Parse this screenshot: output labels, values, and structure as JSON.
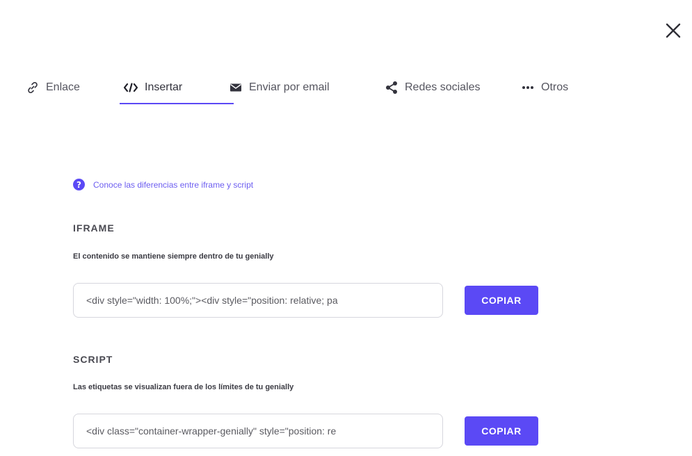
{
  "dialog": {
    "close_icon": "close-icon"
  },
  "tabs": [
    {
      "label": "Enlace",
      "icon": "link-icon"
    },
    {
      "label": "Insertar",
      "icon": "code-icon"
    },
    {
      "label": "Enviar por email",
      "icon": "mail-icon"
    },
    {
      "label": "Redes sociales",
      "icon": "share-icon"
    },
    {
      "label": "Otros",
      "icon": "more-horizontal-icon"
    }
  ],
  "active_tab": "Insertar",
  "help": {
    "icon_glyph": "?",
    "link_text": "Conoce las diferencias entre iframe y script"
  },
  "iframe": {
    "title": "IFRAME",
    "description": "El contenido se mantiene siempre dentro de tu genially",
    "code": "<div style=\"width: 100%;\"><div style=\"position: relative; pa",
    "copy_label": "COPIAR"
  },
  "script": {
    "title": "SCRIPT",
    "description": "Las etiquetas se visualizan fuera de los límites de tu genially",
    "code": "<div class=\"container-wrapper-genially\" style=\"position: re",
    "copy_label": "COPIAR"
  },
  "colors": {
    "accent": "#5b49f5",
    "link": "#6c5df0",
    "text": "#3b3b46"
  }
}
